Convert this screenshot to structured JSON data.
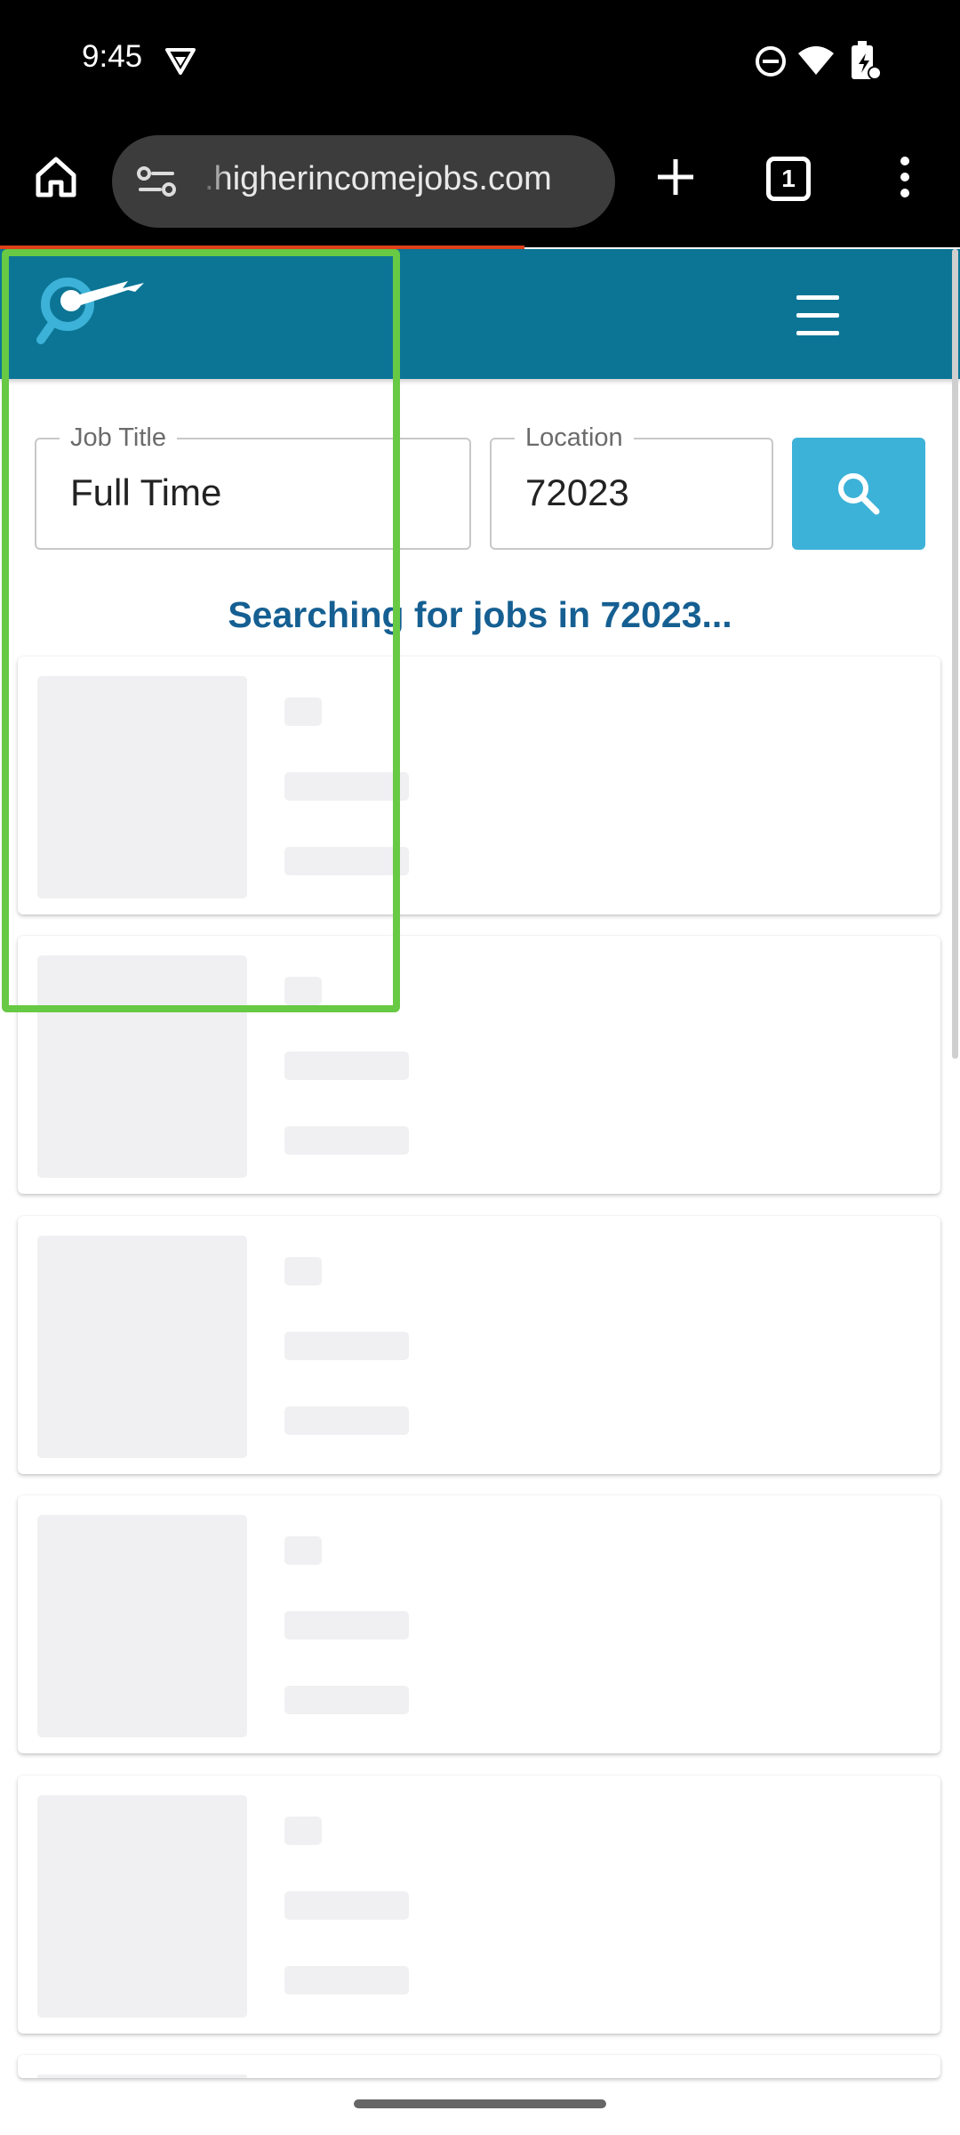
{
  "status_bar": {
    "time": "9:45",
    "icons": [
      "vpn-icon",
      "do-not-disturb-icon",
      "wifi-icon",
      "battery-icon"
    ]
  },
  "browser": {
    "home_icon": "home-icon",
    "site_settings_icon": "site-settings-icon",
    "url": ".higherincomejobs.com",
    "new_tab_icon": "plus-icon",
    "tab_count": "1",
    "menu_icon": "more-vert-icon",
    "load_progress_color": "#e0421a"
  },
  "site": {
    "header_color": "#0c7595",
    "logo_icon": "magnifier-wrench-logo",
    "menu_icon": "hamburger-menu-icon"
  },
  "search": {
    "job_title_label": "Job Title",
    "job_title_value": "Full Time",
    "location_label": "Location",
    "location_value": "72023",
    "button_color": "#3cb2d8",
    "button_icon": "search-icon"
  },
  "status_message": "Searching for jobs in 72023...",
  "status_message_color": "#155f92",
  "highlight_color": "#68c944"
}
